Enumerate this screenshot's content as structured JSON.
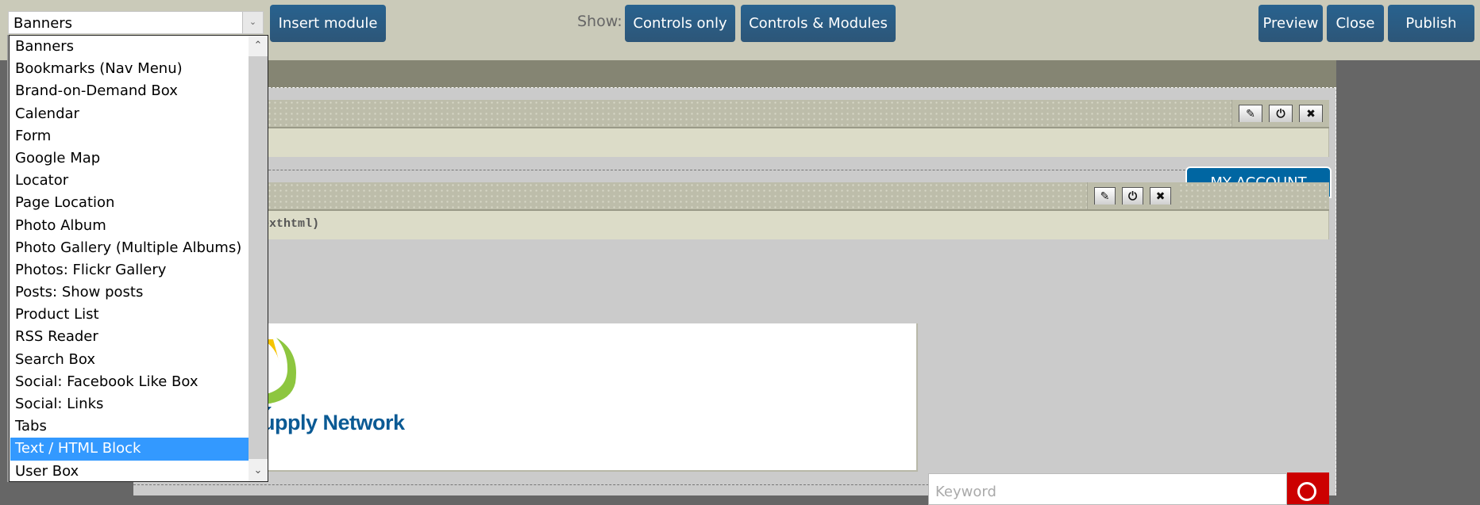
{
  "toolbar": {
    "module_select_value": "Banners",
    "insert_module_label": "Insert module",
    "show_label": "Show:",
    "controls_only_label": "Controls only",
    "controls_modules_label": "Controls & Modules",
    "preview_label": "Preview",
    "close_label": "Close",
    "publish_label": "Publish"
  },
  "dropdown": {
    "options": [
      "Banners",
      "Bookmarks (Nav Menu)",
      "Brand-on-Demand Box",
      "Calendar",
      "Form",
      "Google Map",
      "Locator",
      "Page Location",
      "Photo Album",
      "Photo Gallery (Multiple Albums)",
      "Photos: Flickr Gallery",
      "Posts: Show posts",
      "Product List",
      "RSS Reader",
      "Search Box",
      "Social: Facebook Like Box",
      "Social: Links",
      "Tabs",
      "Text / HTML Block",
      "User Box"
    ],
    "highlighted": "Text / HTML Block"
  },
  "page": {
    "module2_text": "exthtml)",
    "account_tab": "MY ACCOUNT",
    "logo_text": "upply Network",
    "search_placeholder": "Keyword"
  },
  "colors": {
    "button_blue": "#2B5D84",
    "highlight": "#3399FF",
    "account_blue": "#0066A2",
    "search_red": "#CC0000"
  }
}
